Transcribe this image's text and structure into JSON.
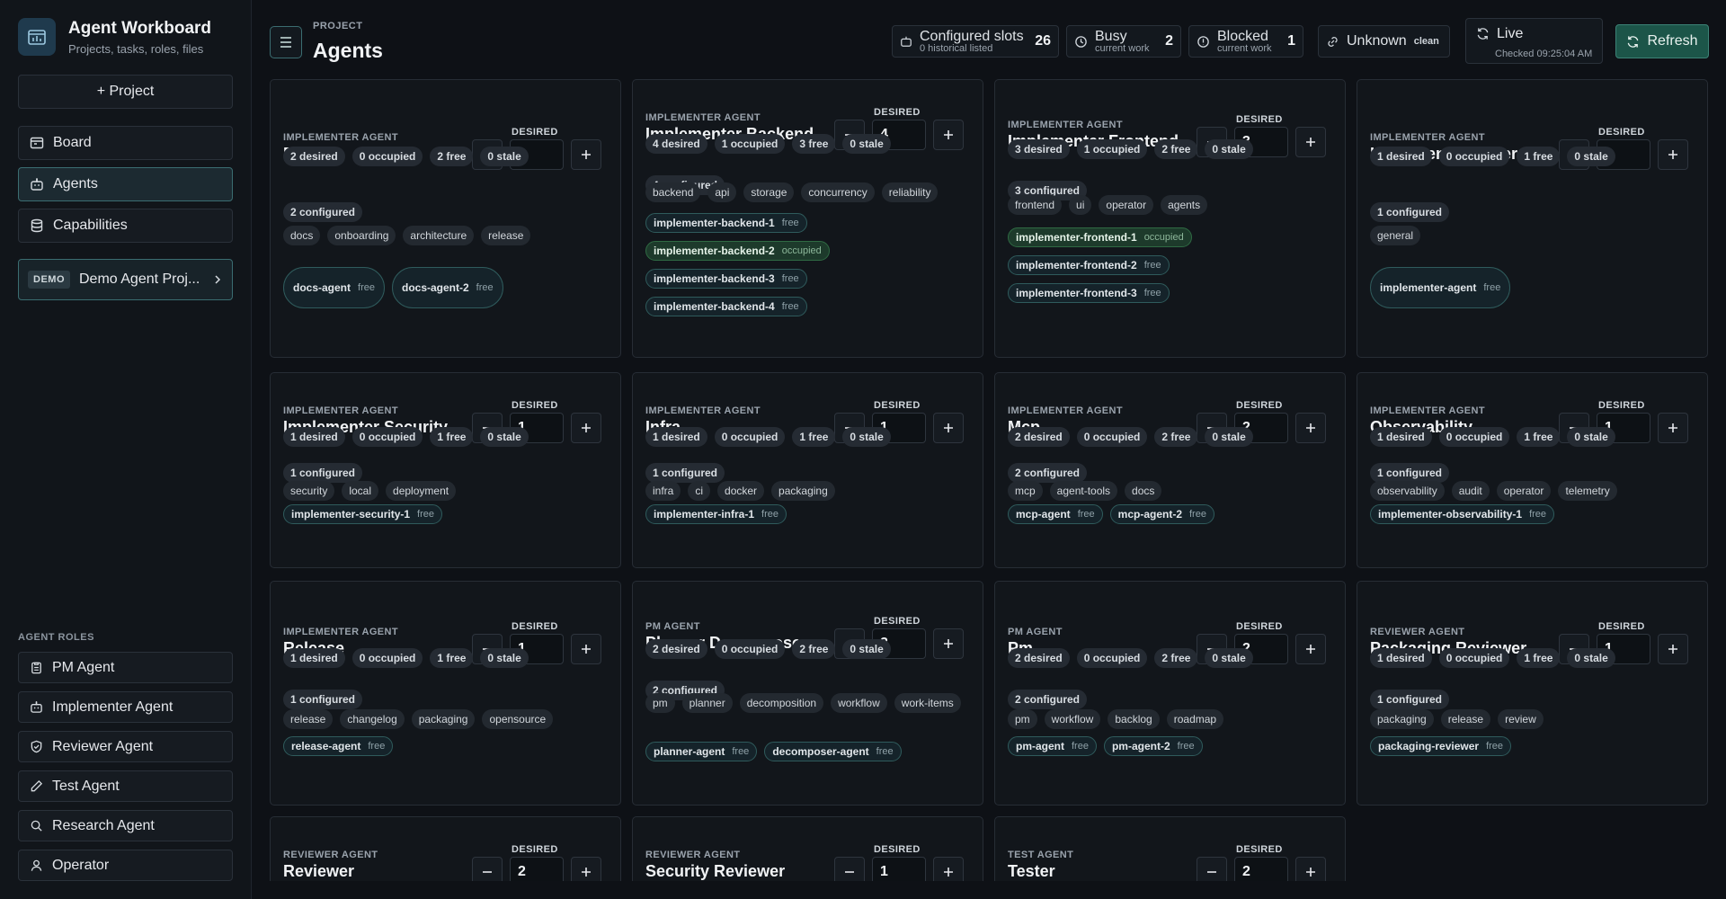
{
  "app": {
    "title": "Agent Workboard",
    "subtitle": "Projects, tasks, roles, files"
  },
  "sidebar": {
    "project_button": "+ Project",
    "nav": [
      {
        "label": "Board"
      },
      {
        "label": "Agents"
      },
      {
        "label": "Capabilities"
      }
    ],
    "demo": {
      "tag": "DEMO",
      "label": "Demo Agent Proj..."
    },
    "roles_heading": "AGENT ROLES",
    "roles": [
      {
        "label": "PM Agent"
      },
      {
        "label": "Implementer Agent"
      },
      {
        "label": "Reviewer Agent"
      },
      {
        "label": "Test Agent"
      },
      {
        "label": "Research Agent"
      },
      {
        "label": "Operator"
      }
    ]
  },
  "header": {
    "kicker": "PROJECT",
    "title": "Agents",
    "configured": {
      "label": "Configured slots",
      "sub": "0 historical listed",
      "value": "26"
    },
    "busy": {
      "label": "Busy",
      "sub": "current work",
      "value": "2"
    },
    "blocked": {
      "label": "Blocked",
      "sub": "current work",
      "value": "1"
    },
    "unknown": {
      "label": "Unknown",
      "badge": "clean"
    },
    "live": {
      "label": "Live",
      "sub": "Checked 09:25:04 AM"
    },
    "refresh": "Refresh"
  },
  "desired_label": "DESIRED",
  "cards": [
    {
      "role": "IMPLEMENTER AGENT",
      "name": "Docs",
      "desired": "2",
      "stats": [
        "2 desired",
        "0 occupied",
        "2 free",
        "0 stale",
        "2 configured"
      ],
      "tags": [
        "docs",
        "onboarding",
        "architecture",
        "release"
      ],
      "slots": [
        {
          "name": "docs-agent",
          "status": "free"
        },
        {
          "name": "docs-agent-2",
          "status": "free"
        }
      ]
    },
    {
      "role": "IMPLEMENTER AGENT",
      "name": "Implementer Backend",
      "desired": "4",
      "stats": [
        "4 desired",
        "1 occupied",
        "3 free",
        "0 stale",
        "4 configured"
      ],
      "tags": [
        "backend",
        "api",
        "storage",
        "concurrency",
        "reliability"
      ],
      "slots": [
        {
          "name": "implementer-backend-1",
          "status": "free"
        },
        {
          "name": "implementer-backend-2",
          "status": "occupied"
        },
        {
          "name": "implementer-backend-3",
          "status": "free"
        },
        {
          "name": "implementer-backend-4",
          "status": "free"
        }
      ]
    },
    {
      "role": "IMPLEMENTER AGENT",
      "name": "Implementer Frontend",
      "desired": "3",
      "stats": [
        "3 desired",
        "1 occupied",
        "2 free",
        "0 stale",
        "3 configured"
      ],
      "tags": [
        "frontend",
        "ui",
        "operator",
        "agents"
      ],
      "slots": [
        {
          "name": "implementer-frontend-1",
          "status": "occupied"
        },
        {
          "name": "implementer-frontend-2",
          "status": "free"
        },
        {
          "name": "implementer-frontend-3",
          "status": "free"
        }
      ]
    },
    {
      "role": "IMPLEMENTER AGENT",
      "name": "Implementer General",
      "desired": "1",
      "stats": [
        "1 desired",
        "0 occupied",
        "1 free",
        "0 stale",
        "1 configured"
      ],
      "tags": [
        "general"
      ],
      "slots": [
        {
          "name": "implementer-agent",
          "status": "free"
        }
      ]
    },
    {
      "role": "IMPLEMENTER AGENT",
      "name": "Implementer Security",
      "desired": "1",
      "stats": [
        "1 desired",
        "0 occupied",
        "1 free",
        "0 stale",
        "1 configured"
      ],
      "tags": [
        "security",
        "local",
        "deployment"
      ],
      "slots": [
        {
          "name": "implementer-security-1",
          "status": "free"
        }
      ]
    },
    {
      "role": "IMPLEMENTER AGENT",
      "name": "Infra",
      "desired": "1",
      "stats": [
        "1 desired",
        "0 occupied",
        "1 free",
        "0 stale",
        "1 configured"
      ],
      "tags": [
        "infra",
        "ci",
        "docker",
        "packaging"
      ],
      "slots": [
        {
          "name": "implementer-infra-1",
          "status": "free"
        }
      ]
    },
    {
      "role": "IMPLEMENTER AGENT",
      "name": "Mcp",
      "desired": "2",
      "stats": [
        "2 desired",
        "0 occupied",
        "2 free",
        "0 stale",
        "2 configured"
      ],
      "tags": [
        "mcp",
        "agent-tools",
        "docs"
      ],
      "slots": [
        {
          "name": "mcp-agent",
          "status": "free"
        },
        {
          "name": "mcp-agent-2",
          "status": "free"
        }
      ]
    },
    {
      "role": "IMPLEMENTER AGENT",
      "name": "Observability",
      "desired": "1",
      "stats": [
        "1 desired",
        "0 occupied",
        "1 free",
        "0 stale",
        "1 configured"
      ],
      "tags": [
        "observability",
        "audit",
        "operator",
        "telemetry"
      ],
      "slots": [
        {
          "name": "implementer-observability-1",
          "status": "free"
        }
      ]
    },
    {
      "role": "IMPLEMENTER AGENT",
      "name": "Release",
      "desired": "1",
      "stats": [
        "1 desired",
        "0 occupied",
        "1 free",
        "0 stale",
        "1 configured"
      ],
      "tags": [
        "release",
        "changelog",
        "packaging",
        "opensource"
      ],
      "slots": [
        {
          "name": "release-agent",
          "status": "free"
        }
      ]
    },
    {
      "role": "PM AGENT",
      "name": "Planner Decomposer",
      "desired": "2",
      "stats": [
        "2 desired",
        "0 occupied",
        "2 free",
        "0 stale",
        "2 configured"
      ],
      "tags": [
        "pm",
        "planner",
        "decomposition",
        "workflow",
        "work-items"
      ],
      "slots": [
        {
          "name": "planner-agent",
          "status": "free"
        },
        {
          "name": "decomposer-agent",
          "status": "free"
        }
      ]
    },
    {
      "role": "PM AGENT",
      "name": "Pm",
      "desired": "2",
      "stats": [
        "2 desired",
        "0 occupied",
        "2 free",
        "0 stale",
        "2 configured"
      ],
      "tags": [
        "pm",
        "workflow",
        "backlog",
        "roadmap"
      ],
      "slots": [
        {
          "name": "pm-agent",
          "status": "free"
        },
        {
          "name": "pm-agent-2",
          "status": "free"
        }
      ]
    },
    {
      "role": "REVIEWER AGENT",
      "name": "Packaging Reviewer",
      "desired": "1",
      "stats": [
        "1 desired",
        "0 occupied",
        "1 free",
        "0 stale",
        "1 configured"
      ],
      "tags": [
        "packaging",
        "release",
        "review"
      ],
      "slots": [
        {
          "name": "packaging-reviewer",
          "status": "free"
        }
      ]
    },
    {
      "role": "REVIEWER AGENT",
      "name": "Reviewer",
      "desired": "2",
      "stats": [],
      "tags": [],
      "slots": []
    },
    {
      "role": "REVIEWER AGENT",
      "name": "Security Reviewer",
      "desired": "1",
      "stats": [],
      "tags": [],
      "slots": []
    },
    {
      "role": "TEST AGENT",
      "name": "Tester",
      "desired": "2",
      "stats": [],
      "tags": [],
      "slots": []
    }
  ]
}
